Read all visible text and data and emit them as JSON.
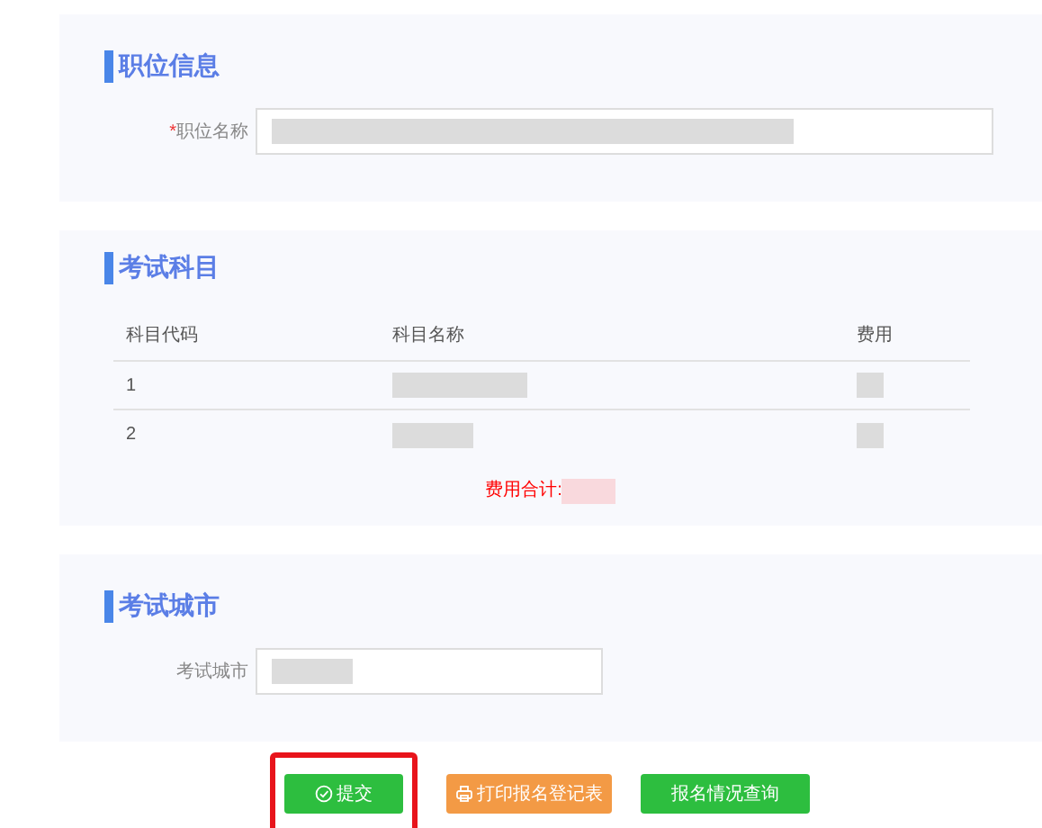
{
  "sections": [
    {
      "kind": "form",
      "title": "职位信息",
      "fields": [
        {
          "label": "职位名称",
          "marker": "*",
          "redacted": true,
          "wide": true
        }
      ]
    },
    {
      "kind": "table",
      "title": "考试科目",
      "table": {
        "columns": [
          "科目代码",
          "科目名称",
          "费用"
        ],
        "rows": [
          {
            "code": "1",
            "redacted": true
          },
          {
            "code": "2",
            "redacted": true
          }
        ]
      },
      "total_label": "费用合计:",
      "total_redacted": true
    },
    {
      "kind": "form",
      "title": "考试城市",
      "fields": [
        {
          "label": "考试城市",
          "redacted": true,
          "wide": false
        }
      ]
    }
  ],
  "buttons": [
    {
      "label": "提交",
      "kind": "submit",
      "highlighted": true
    },
    {
      "label": "打印报名登记表",
      "kind": "print",
      "highlighted": false
    },
    {
      "label": "报名情况查询",
      "kind": "query",
      "highlighted": false
    }
  ]
}
